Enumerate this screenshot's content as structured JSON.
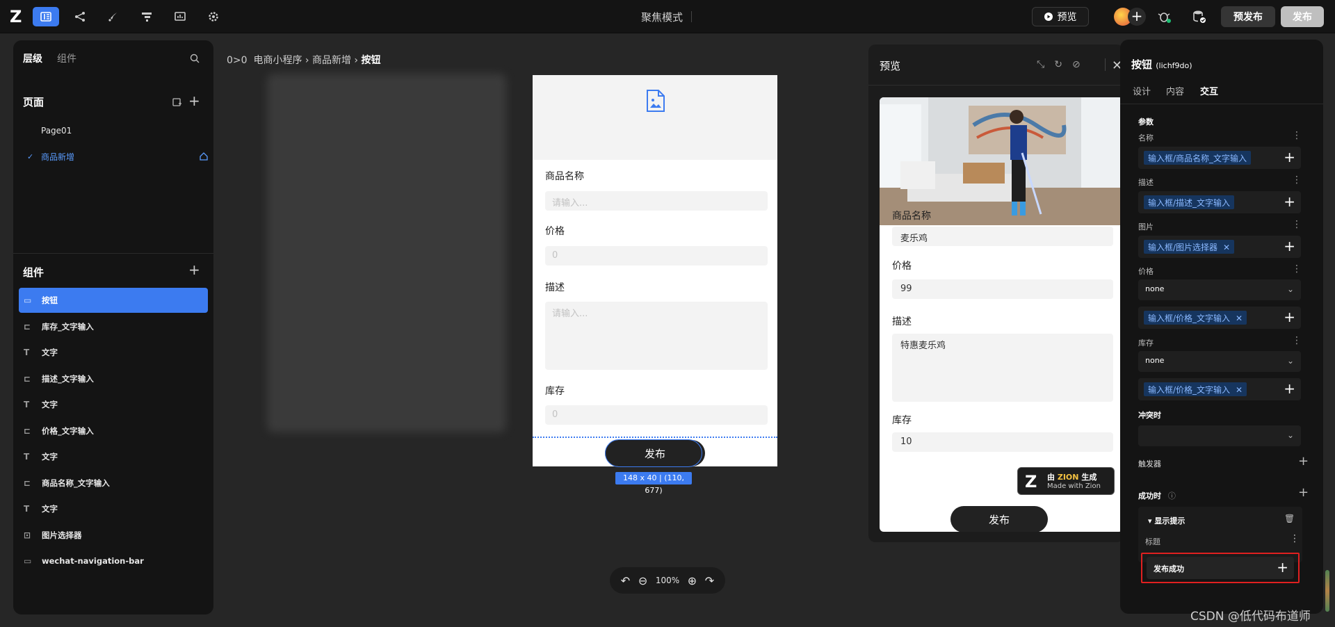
{
  "topbar": {
    "logo": "Z",
    "focus_mode": "聚焦模式",
    "preview_label": "预览",
    "prepublish_label": "预发布",
    "publish_label": "发布",
    "accent": "#3c7bf0"
  },
  "left_panel": {
    "tabs": [
      "层级",
      "组件"
    ],
    "pages_title": "页面",
    "pages": [
      "Page01",
      "商品新增"
    ],
    "components_title": "组件",
    "components": [
      {
        "label": "按钮",
        "icon": "button-icon"
      },
      {
        "label": "库存_文字输入",
        "icon": "input-icon"
      },
      {
        "label": "文字",
        "icon": "text-icon"
      },
      {
        "label": "描述_文字输入",
        "icon": "input-icon"
      },
      {
        "label": "文字",
        "icon": "text-icon"
      },
      {
        "label": "价格_文字输入",
        "icon": "input-icon"
      },
      {
        "label": "文字",
        "icon": "text-icon"
      },
      {
        "label": "商品名称_文字输入",
        "icon": "input-icon"
      },
      {
        "label": "文字",
        "icon": "text-icon"
      },
      {
        "label": "图片选择器",
        "icon": "image-picker-icon"
      },
      {
        "label": "wechat-navigation-bar",
        "icon": "navbar-icon"
      }
    ]
  },
  "breadcrumb": {
    "prefix": "0>0",
    "app": "电商小程序",
    "page": "商品新增",
    "current": "按钮"
  },
  "canvas": {
    "labels": [
      "商品名称",
      "价格",
      "描述",
      "库存"
    ],
    "placeholders": [
      "请输入...",
      "0",
      "请输入...",
      "0"
    ],
    "button_label": "发布",
    "size_badge": "148 x 40 | (110, 677)",
    "zoom": "100%"
  },
  "preview": {
    "title": "预览",
    "labels": [
      "商品名称",
      "价格",
      "描述",
      "库存"
    ],
    "values": [
      "麦乐鸡",
      "99",
      "特惠麦乐鸡",
      "10"
    ],
    "button_label": "发布",
    "badge_prefix": "由",
    "badge_brand": "ZION",
    "badge_suffix": "生成",
    "badge_line2": "Made with Zion"
  },
  "right_panel": {
    "title": "按钮",
    "id": "(lichf9do)",
    "tabs": [
      "设计",
      "内容",
      "交互"
    ],
    "params_title": "参数",
    "name_label": "名称",
    "name_value": "输入框/商品名称_文字输入",
    "desc_label": "描述",
    "desc_value": "输入框/描述_文字输入",
    "image_label": "图片",
    "image_value": "输入框/图片选择器",
    "price_label": "价格",
    "price_select": "none",
    "price_value": "输入框/价格_文字输入",
    "stock_label": "库存",
    "stock_select": "none",
    "stock_value": "输入框/价格_文字输入",
    "conflict_label": "冲突时",
    "trigger_label": "触发器",
    "success_label": "成功时",
    "show_toast": "显示提示",
    "toast_title_label": "标题",
    "toast_title_value": "发布成功"
  },
  "watermark": "CSDN @低代码布道师"
}
